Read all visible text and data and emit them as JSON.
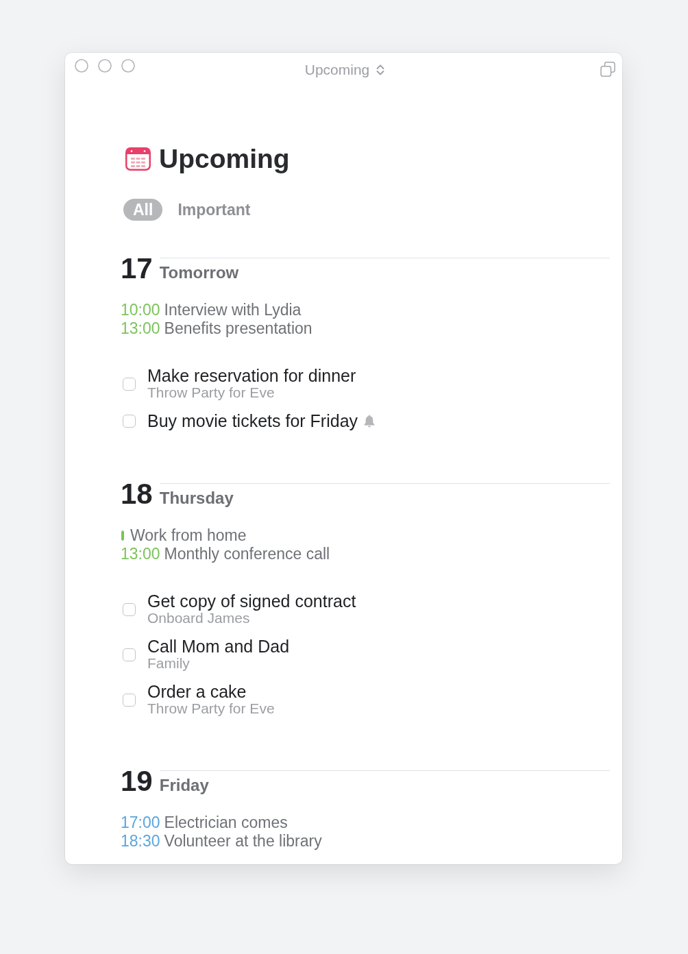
{
  "window": {
    "title": "Upcoming"
  },
  "header": {
    "title": "Upcoming"
  },
  "filters": [
    {
      "label": "All",
      "selected": true
    },
    {
      "label": "Important",
      "selected": false
    }
  ],
  "days": [
    {
      "day": "17",
      "label": "Tomorrow",
      "events": [
        {
          "kind": "timed",
          "time": "10:00",
          "title": "Interview with Lydia",
          "color": "#7cc35a"
        },
        {
          "kind": "timed",
          "time": "13:00",
          "title": "Benefits presentation",
          "color": "#7cc35a"
        }
      ],
      "tasks": [
        {
          "title": "Make reservation for dinner",
          "project": "Throw Party for Eve",
          "checked": false,
          "reminder": false
        },
        {
          "title": "Buy movie tickets for Friday",
          "checked": false,
          "reminder": true
        }
      ]
    },
    {
      "day": "18",
      "label": "Thursday",
      "events": [
        {
          "kind": "all_day",
          "title": "Work from home",
          "color": "#7cc35a"
        },
        {
          "kind": "timed",
          "time": "13:00",
          "title": "Monthly conference call",
          "color": "#7cc35a"
        }
      ],
      "tasks": [
        {
          "title": "Get copy of signed contract",
          "project": "Onboard James",
          "checked": false,
          "reminder": false
        },
        {
          "title": "Call Mom and Dad",
          "project": "Family",
          "checked": false,
          "reminder": false
        },
        {
          "title": "Order a cake",
          "project": "Throw Party for Eve",
          "checked": false,
          "reminder": false
        }
      ]
    },
    {
      "day": "19",
      "label": "Friday",
      "events": [
        {
          "kind": "timed",
          "time": "17:00",
          "title": "Electrician comes",
          "color": "#5aa5dc"
        },
        {
          "kind": "timed",
          "time": "18:30",
          "title": "Volunteer at the library",
          "color": "#5aa5dc"
        }
      ]
    }
  ]
}
